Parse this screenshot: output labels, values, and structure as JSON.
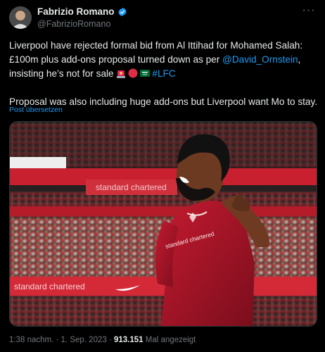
{
  "author": {
    "name": "Fabrizio Romano",
    "handle": "@FabrizioRomano",
    "verified": true,
    "accent": "#1d9bf0"
  },
  "tweet": {
    "line1_before": "Liverpool have rejected formal bid from Al Ittihad for Mohamed Salah: £100m plus add-ons proposal turned down as per ",
    "mention": "@David_Ornstein",
    "line1_after": ", insisting he’s not for sale ",
    "emojis": [
      "police-light-icon",
      "red-circle-icon",
      "saudi-flag-icon"
    ],
    "hashtag": "#LFC",
    "paragraph2": "Proposal was also including huge add-ons but Liverpool want Mo to stay."
  },
  "translate_label": "Post übersetzen",
  "meta": {
    "time": "1:38 nachm.",
    "separator": " · ",
    "date": "1. Sep. 2023",
    "views_count": "913.151",
    "views_label": "Mal angezeigt"
  },
  "media": {
    "ad_boards": [
      "standard chartered",
      "standard chartered"
    ],
    "shirt_sponsor": "standard chartered",
    "kit_color": "#b0152a"
  }
}
